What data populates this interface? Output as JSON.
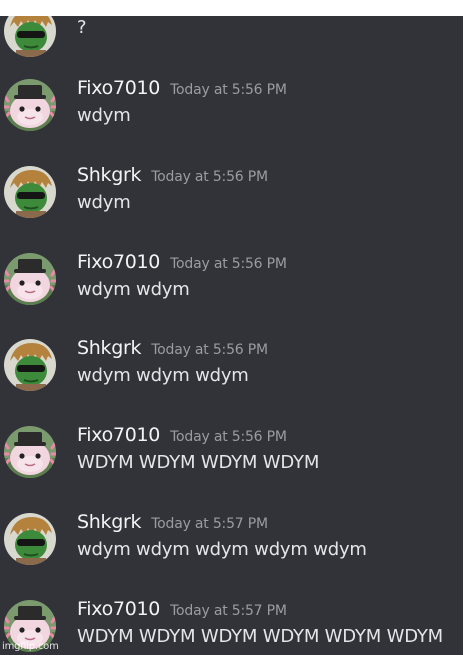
{
  "chat": {
    "partial_message": {
      "text": "?",
      "avatar": "shkgrk-avatar"
    },
    "messages": [
      {
        "username": "Fixo7010",
        "timestamp": "Today at 5:56 PM",
        "text": "wdym",
        "avatar": "axolotl-avatar"
      },
      {
        "username": "Shkgrk",
        "timestamp": "Today at 5:56 PM",
        "text": "wdym",
        "avatar": "shkgrk-avatar"
      },
      {
        "username": "Fixo7010",
        "timestamp": "Today at 5:56 PM",
        "text": "wdym wdym",
        "avatar": "axolotl-avatar"
      },
      {
        "username": "Shkgrk",
        "timestamp": "Today at 5:56 PM",
        "text": "wdym wdym wdym",
        "avatar": "shkgrk-avatar"
      },
      {
        "username": "Fixo7010",
        "timestamp": "Today at 5:56 PM",
        "text": "WDYM WDYM WDYM WDYM",
        "avatar": "axolotl-avatar"
      },
      {
        "username": "Shkgrk",
        "timestamp": "Today at 5:57 PM",
        "text": "wdym wdym wdym wdym wdym",
        "avatar": "shkgrk-avatar"
      },
      {
        "username": "Fixo7010",
        "timestamp": "Today at 5:57 PM",
        "text": "WDYM WDYM WDYM WDYM WDYM WDYM",
        "avatar": "axolotl-avatar"
      }
    ]
  },
  "watermark": {
    "text": "imgflip.com"
  },
  "colors": {
    "background": "#313338",
    "username": "#f2f3f5",
    "timestamp": "#9a9ca3",
    "message": "#e3e5e8"
  }
}
